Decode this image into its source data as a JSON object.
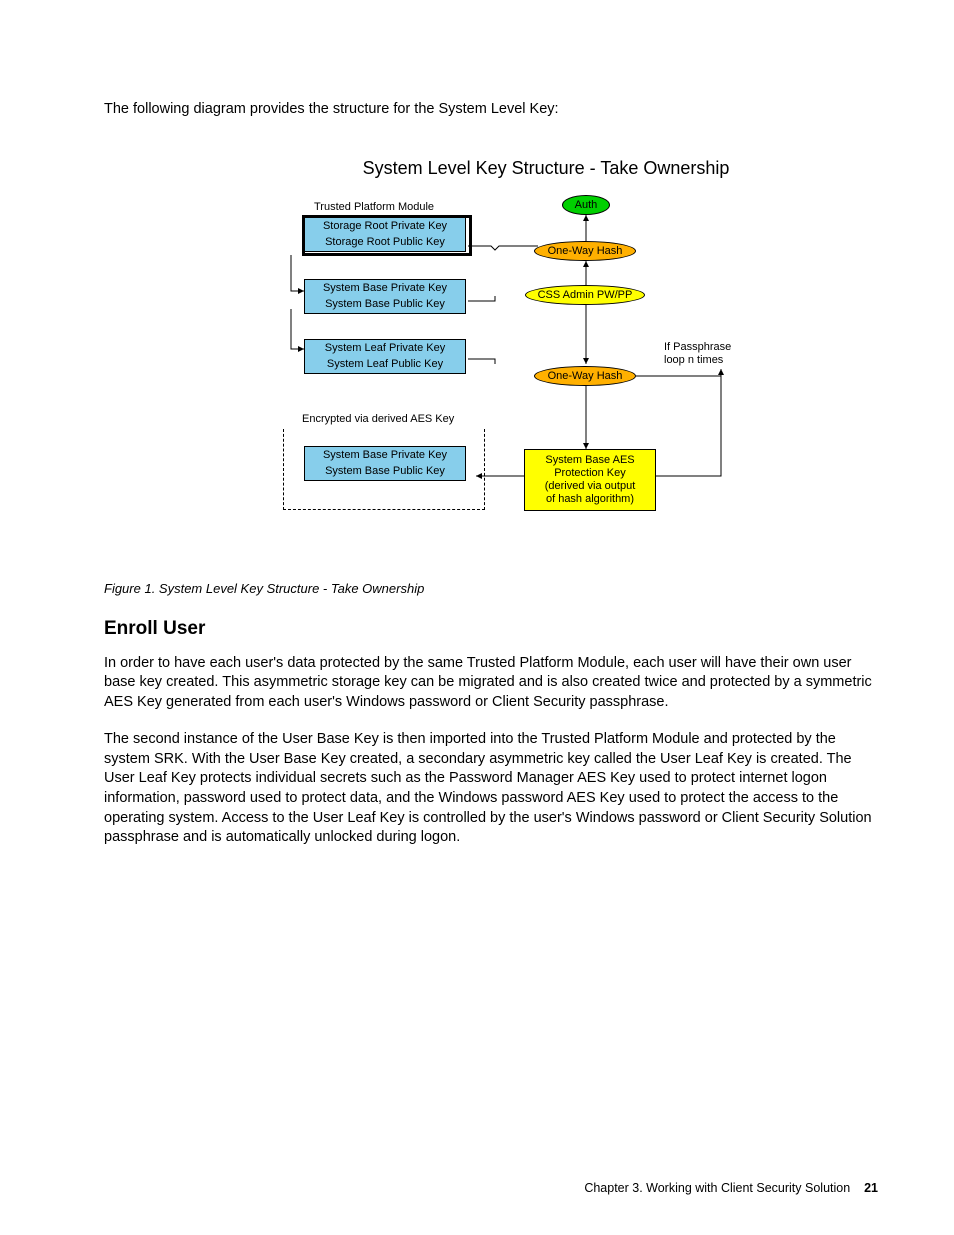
{
  "intro": "The following diagram provides the structure for the System Level Key:",
  "diagram": {
    "title": "System Level Key Structure - Take Ownership",
    "tpm_label": "Trusted Platform Module",
    "srk_priv": "Storage Root Private Key",
    "srk_pub": "Storage Root Public Key",
    "sysbase_priv": "System Base Private Key",
    "sysbase_pub": "System Base Public Key",
    "sysleaf_priv": "System Leaf Private Key",
    "sysleaf_pub": "System Leaf Public Key",
    "aes_label": "Encrypted via derived AES Key",
    "sysbase_priv2": "System Base Private Key",
    "sysbase_pub2": "System Base Public Key",
    "auth": "Auth",
    "hash1": "One-Way Hash",
    "admin_pw": "CSS Admin PW/PP",
    "hash2": "One-Way Hash",
    "loop_note_l1": "If Passphrase",
    "loop_note_l2": "loop n times",
    "aes_key_l1": "System Base AES",
    "aes_key_l2": "Protection Key",
    "aes_key_l3": "(derived via output",
    "aes_key_l4": "of hash algorithm)"
  },
  "figure_caption": "Figure 1.  System Level Key Structure - Take Ownership",
  "section_heading": "Enroll User",
  "para1": "In order to have each user's data protected by the same Trusted Platform Module, each user will have their own user base key created. This asymmetric storage key can be migrated and is also created twice and protected by a symmetric AES Key generated from each user's Windows password or Client Security passphrase.",
  "para2": "The second instance of the User Base Key is then imported into the Trusted Platform Module and protected by the system SRK. With the User Base Key created, a secondary asymmetric key called the User Leaf Key is created. The User Leaf Key protects individual secrets such as the Password Manager AES Key used to protect internet logon information, password used to protect data, and the Windows password AES Key used to protect the access to the operating system. Access to the User Leaf Key is controlled by the user's Windows password or Client Security Solution passphrase and is automatically unlocked during logon.",
  "footer_chapter": "Chapter 3.  Working with Client Security Solution",
  "footer_page": "21"
}
